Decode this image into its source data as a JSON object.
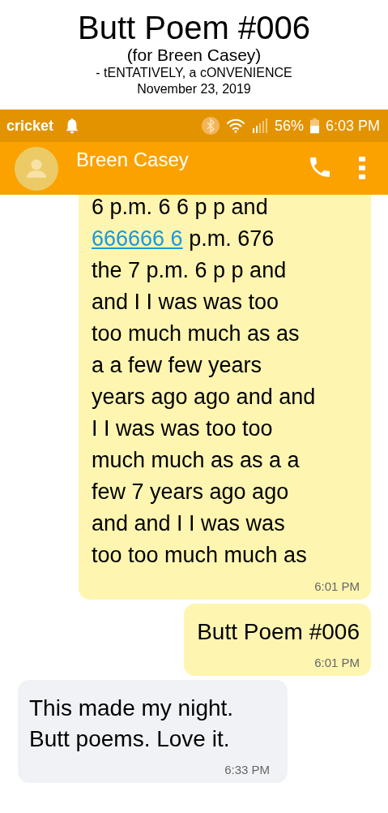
{
  "header": {
    "title": "Butt Poem #006",
    "dedication": "(for Breen Casey)",
    "author": "- tENTATIVELY, a cONVENIENCE",
    "date": "November 23, 2019"
  },
  "status_bar": {
    "carrier": "cricket",
    "battery": "56%",
    "time": "6:03 PM"
  },
  "app_bar": {
    "contact": "Breen Casey"
  },
  "messages": [
    {
      "kind": "sent",
      "lines": [
        [
          {
            "kind": "plain",
            "text": "6 p.m. 6 6 p p and"
          }
        ],
        [
          {
            "kind": "link",
            "text": "666666 6"
          },
          {
            "kind": "plain",
            "text": " p.m. 676"
          }
        ],
        [
          {
            "kind": "plain",
            "text": "the 7 p.m. 6 p p and"
          }
        ],
        [
          {
            "kind": "plain",
            "text": "and I I was was too"
          }
        ],
        [
          {
            "kind": "plain",
            "text": "too much much as as"
          }
        ],
        [
          {
            "kind": "plain",
            "text": "a a few few years"
          }
        ],
        [
          {
            "kind": "plain",
            "text": "years ago ago and and"
          }
        ],
        [
          {
            "kind": "plain",
            "text": "I I was was too too"
          }
        ],
        [
          {
            "kind": "plain",
            "text": "much much as as a a"
          }
        ],
        [
          {
            "kind": "plain",
            "text": "few 7 years ago ago"
          }
        ],
        [
          {
            "kind": "plain",
            "text": "and and I I was was"
          }
        ],
        [
          {
            "kind": "plain",
            "text": "too too much much as"
          }
        ]
      ],
      "time": "6:01 PM"
    },
    {
      "kind": "sent",
      "lines": [
        [
          {
            "kind": "plain",
            "text": "Butt Poem #006"
          }
        ]
      ],
      "time": "6:01 PM"
    },
    {
      "kind": "received",
      "lines": [
        [
          {
            "kind": "plain",
            "text": "This made my night."
          }
        ],
        [
          {
            "kind": "plain",
            "text": "Butt poems. Love it."
          }
        ]
      ],
      "time": "6:33 PM"
    }
  ]
}
